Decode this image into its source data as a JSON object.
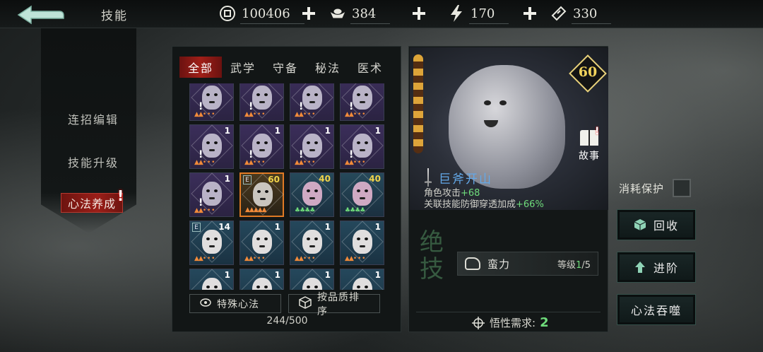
{
  "header": {
    "title": "技能",
    "resources": [
      {
        "icon": "coin-icon",
        "value": "100406"
      },
      {
        "icon": "silver-ingot-icon",
        "value": "384"
      },
      {
        "icon": "lightning-icon",
        "value": "170"
      },
      {
        "icon": "ticket-icon",
        "value": "330"
      }
    ]
  },
  "sidebar": {
    "items": [
      {
        "label": "连招编辑"
      },
      {
        "label": "技能升级"
      },
      {
        "label": "心法养成"
      }
    ],
    "badge": "!"
  },
  "tabs": [
    {
      "label": "全部",
      "active": true
    },
    {
      "label": "武学"
    },
    {
      "label": "守备"
    },
    {
      "label": "秘法"
    },
    {
      "label": "医术"
    }
  ],
  "grid": {
    "cells": [
      {
        "bg": "purple",
        "face": "purple",
        "count": "",
        "warn": "!",
        "pips": "▲▲• • •"
      },
      {
        "bg": "purple",
        "face": "purple",
        "count": "",
        "warn": "!",
        "pips": "▲▲• • •"
      },
      {
        "bg": "purple",
        "face": "purple",
        "count": "",
        "warn": "!",
        "pips": "▲▲• • •"
      },
      {
        "bg": "purple",
        "face": "purple",
        "count": "",
        "warn": "!",
        "pips": "▲▲• • •"
      },
      {
        "bg": "purple",
        "face": "purple",
        "count": "1",
        "warn": "!",
        "pips": "▲▲• • •"
      },
      {
        "bg": "purple",
        "face": "purple",
        "count": "1",
        "warn": "!",
        "pips": "▲▲• • •"
      },
      {
        "bg": "purple",
        "face": "purple",
        "count": "1",
        "warn": "!",
        "pips": "▲▲• • •"
      },
      {
        "bg": "purple",
        "face": "purple",
        "count": "1",
        "warn": "!",
        "pips": "▲▲• • •"
      },
      {
        "bg": "purple",
        "face": "purple",
        "count": "1",
        "warn": "!",
        "pips": "▲▲• • •"
      },
      {
        "bg": "orange",
        "face": "grey",
        "count": "60",
        "gold": true,
        "ebadge": "E",
        "pips": "▲▲▲▲▲"
      },
      {
        "bg": "teal",
        "face": "pink",
        "count": "40",
        "gold": true,
        "pips": "♣♣♣♣"
      },
      {
        "bg": "teal",
        "face": "pink",
        "count": "40",
        "gold": true,
        "pips": "♣♣♣♣"
      },
      {
        "bg": "blue",
        "face": "white",
        "count": "14",
        "ebadge": "E",
        "pips": "▲▲• • •"
      },
      {
        "bg": "blue",
        "face": "white",
        "count": "1",
        "pips": "▲▲• • •"
      },
      {
        "bg": "blue",
        "face": "white",
        "count": "1",
        "pips": "▲▲• • •"
      },
      {
        "bg": "blue",
        "face": "white",
        "count": "1",
        "pips": "▲▲• • •"
      },
      {
        "bg": "blue",
        "face": "white",
        "count": "1",
        "pips": ""
      },
      {
        "bg": "blue",
        "face": "white",
        "count": "1",
        "pips": ""
      },
      {
        "bg": "blue",
        "face": "white",
        "count": "1",
        "pips": ""
      },
      {
        "bg": "blue",
        "face": "white",
        "count": "1",
        "pips": ""
      }
    ],
    "special_label": "特殊心法",
    "sort_label": "按品质排序",
    "count_text": "244/500"
  },
  "detail": {
    "level": "60",
    "story_label": "故事",
    "story_badge": "!",
    "skill_name": "巨斧开山",
    "stat1_label": "角色攻击",
    "stat1_value": "+68",
    "stat2_label": "关联技能防御穿透加成",
    "stat2_value": "+66%",
    "vert_title": "绝技",
    "talent_name": "蛮力",
    "talent_level_label": "等级",
    "talent_level_cur": "1",
    "talent_level_max": "/5",
    "require_label": "悟性需求:",
    "require_value": "2"
  },
  "right": {
    "protect_label": "消耗保护",
    "recycle_label": "回收",
    "advance_label": "进阶",
    "devour_label": "心法吞噬"
  }
}
